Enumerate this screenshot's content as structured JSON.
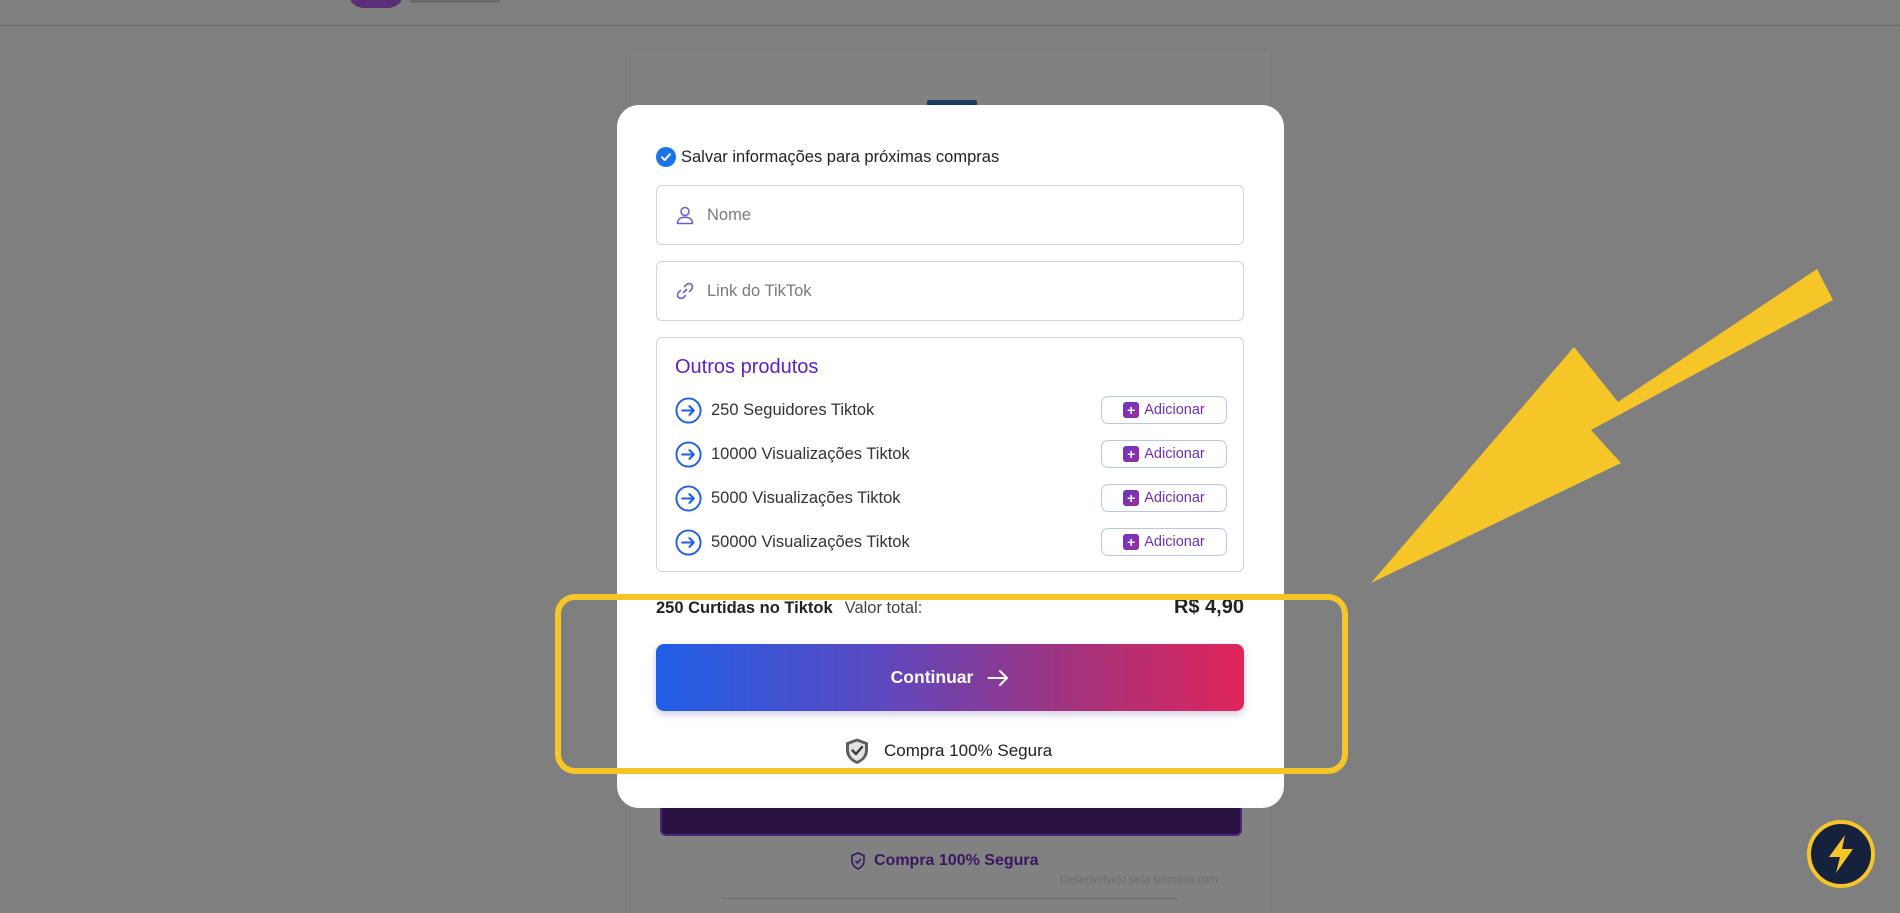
{
  "modal": {
    "save_info_label": "Salvar informações para próximas compras",
    "name_placeholder": "Nome",
    "link_placeholder": "Link do TikTok",
    "products_title": "Outros produtos",
    "products": [
      {
        "label": "250 Seguidores Tiktok",
        "button": "Adicionar"
      },
      {
        "label": "10000 Visualizações Tiktok",
        "button": "Adicionar"
      },
      {
        "label": "5000 Visualizações Tiktok",
        "button": "Adicionar"
      },
      {
        "label": "50000 Visualizações Tiktok",
        "button": "Adicionar"
      }
    ],
    "summary": {
      "product": "250 Curtidas no Tiktok",
      "total_label": "Valor total:",
      "price": "R$ 4,90"
    },
    "continue_label": "Continuar",
    "secure_label": "Compra 100% Segura"
  },
  "background": {
    "secure_label": "Compra 100% Segura",
    "developer_credit": "Desenvolvido pela smmloja.com"
  },
  "colors": {
    "annotation": "#f6c629",
    "accent_blue": "#1a73e8",
    "accent_purple": "#5b1fc9",
    "gradient_start": "#1f5fe6",
    "gradient_end": "#e0255a",
    "fab_background": "#16213e"
  },
  "icons": {
    "check": "check-circle-icon",
    "user": "user-icon",
    "link": "link-icon",
    "product_arrow": "arrow-right-circle-icon",
    "add": "plus-square-icon",
    "continue_arrow": "arrow-right-icon",
    "secure_shield": "shield-check-icon",
    "fab": "lightning-icon"
  }
}
